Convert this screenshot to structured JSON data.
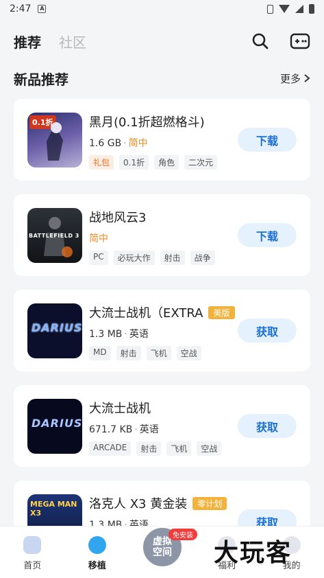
{
  "status_bar": {
    "time": "2:47",
    "notif_icon": "A"
  },
  "header": {
    "tabs": [
      {
        "label": "推荐"
      },
      {
        "label": "社区"
      }
    ]
  },
  "section": {
    "title": "新品推荐",
    "more_label": "更多"
  },
  "games": [
    {
      "title": "黑月(0.1折超燃格斗)",
      "size": "1.6 GB",
      "lang": "简中",
      "badge": "",
      "tags": [
        "礼包",
        "0.1折",
        "角色",
        "二次元"
      ],
      "action": "下载",
      "thumb_text": "0.1折",
      "thumb_color": "#4a4f8a"
    },
    {
      "title": "战地风云3",
      "size": "",
      "lang": "简中",
      "badge": "",
      "tags": [
        "PC",
        "必玩大作",
        "射击",
        "战争"
      ],
      "action": "下载",
      "thumb_text": "BATTLEFIELD 3",
      "thumb_color": "#1b1e24"
    },
    {
      "title": "大流士战机（EXTRA",
      "size": "1.3 MB",
      "lang": "英语",
      "badge": "美版",
      "tags": [
        "MD",
        "射击",
        "飞机",
        "空战"
      ],
      "action": "获取",
      "thumb_text": "DARIUS",
      "thumb_color": "#0b0f2c"
    },
    {
      "title": "大流士战机",
      "size": "671.7 KB",
      "lang": "英语",
      "badge": "",
      "tags": [
        "ARCADE",
        "射击",
        "飞机",
        "空战"
      ],
      "action": "获取",
      "thumb_text": "DARIUS",
      "thumb_color": "#070a1f"
    },
    {
      "title": "洛克人 X3 黄金装",
      "size": "1.3 MB",
      "lang": "英语",
      "badge": "零计划",
      "tags": [],
      "action": "获取",
      "thumb_text": "MEGA MAN X3",
      "thumb_color": "#13204a"
    }
  ],
  "bottom_nav": {
    "items": [
      {
        "label": "首页"
      },
      {
        "label": "移植"
      },
      {
        "label": "福利"
      },
      {
        "label": "我的"
      }
    ],
    "center_label_1": "虚拟",
    "center_label_2": "空间",
    "install_badge": "免安装"
  },
  "watermark": "大玩客",
  "colors": {
    "accent": "#1a6fd6",
    "orange": "#f08a1c",
    "gold": "#f2b33d"
  }
}
